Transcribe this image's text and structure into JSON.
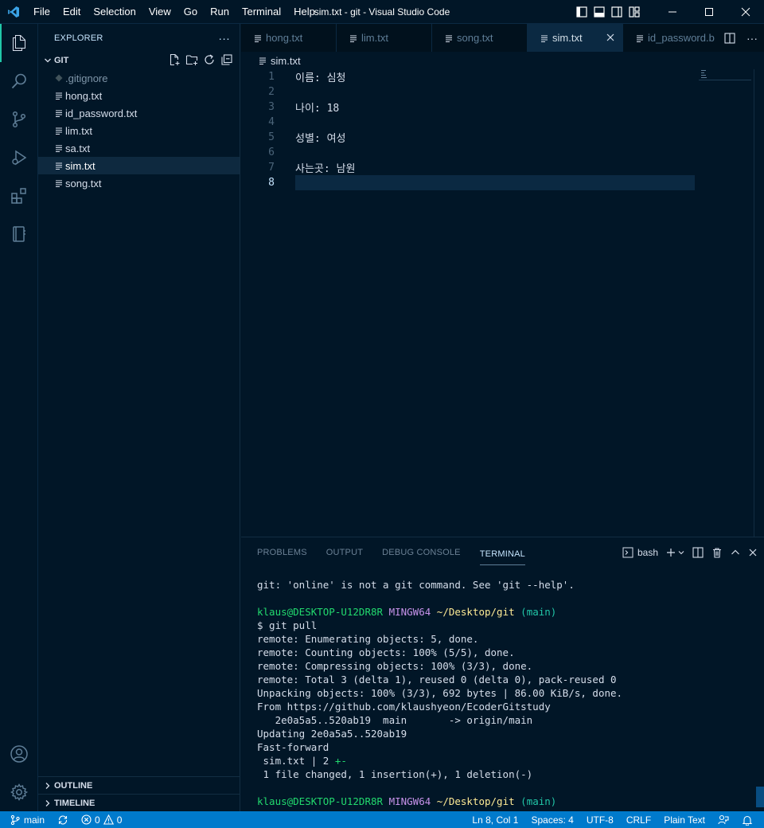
{
  "window": {
    "title": "sim.txt - git - Visual Studio Code",
    "menu": [
      "File",
      "Edit",
      "Selection",
      "View",
      "Go",
      "Run",
      "Terminal",
      "Help"
    ]
  },
  "sidebar": {
    "title": "EXPLORER",
    "more": "···",
    "folder": "GIT",
    "files": [
      ".gitignore",
      "hong.txt",
      "id_password.txt",
      "lim.txt",
      "sa.txt",
      "sim.txt",
      "song.txt"
    ],
    "selected_file": "sim.txt",
    "outline": "OUTLINE",
    "timeline": "TIMELINE"
  },
  "tabs": [
    {
      "label": "hong.txt"
    },
    {
      "label": "lim.txt"
    },
    {
      "label": "song.txt"
    },
    {
      "label": "sim.txt",
      "active": true
    },
    {
      "label": "id_password.b"
    }
  ],
  "breadcrumb": "sim.txt",
  "editor": {
    "lines": [
      {
        "num": "1",
        "text": "이름: 심청"
      },
      {
        "num": "2",
        "text": ""
      },
      {
        "num": "3",
        "text": "나이: 18"
      },
      {
        "num": "4",
        "text": ""
      },
      {
        "num": "5",
        "text": "성별: 여성"
      },
      {
        "num": "6",
        "text": ""
      },
      {
        "num": "7",
        "text": "사는곳: 남원"
      },
      {
        "num": "8",
        "text": ""
      }
    ],
    "current_line": 8
  },
  "panel": {
    "tabs": [
      "PROBLEMS",
      "OUTPUT",
      "DEBUG CONSOLE",
      "TERMINAL"
    ],
    "active_tab": "TERMINAL",
    "shell": "bash",
    "terminal": {
      "error_line": "git: 'online' is not a git command. See 'git --help'.",
      "prompt_user": "klaus@DESKTOP-U12DR8R",
      "prompt_env": "MINGW64",
      "prompt_path": "~/Desktop/git",
      "prompt_branch": "(main)",
      "command": "$ git pull",
      "output": [
        "remote: Enumerating objects: 5, done.",
        "remote: Counting objects: 100% (5/5), done.",
        "remote: Compressing objects: 100% (3/3), done.",
        "remote: Total 3 (delta 1), reused 0 (delta 0), pack-reused 0",
        "Unpacking objects: 100% (3/3), 692 bytes | 86.00 KiB/s, done.",
        "From https://github.com/klaushyeon/EcoderGitstudy",
        "   2e0a5a5..520ab19  main       -> origin/main",
        "Updating 2e0a5a5..520ab19",
        "Fast-forward"
      ],
      "diffstat_file": " sim.txt | 2 ",
      "diffstat_marks": "+-",
      "summary": " 1 file changed, 1 insertion(+), 1 deletion(-)"
    }
  },
  "status": {
    "branch": "main",
    "errors": "0",
    "warnings": "0",
    "position": "Ln 8, Col 1",
    "spaces": "Spaces: 4",
    "encoding": "UTF-8",
    "eol": "CRLF",
    "language": "Plain Text"
  },
  "colors": {
    "background": "#011627",
    "status_bar": "#007acc",
    "accent": "#21c7a8"
  }
}
